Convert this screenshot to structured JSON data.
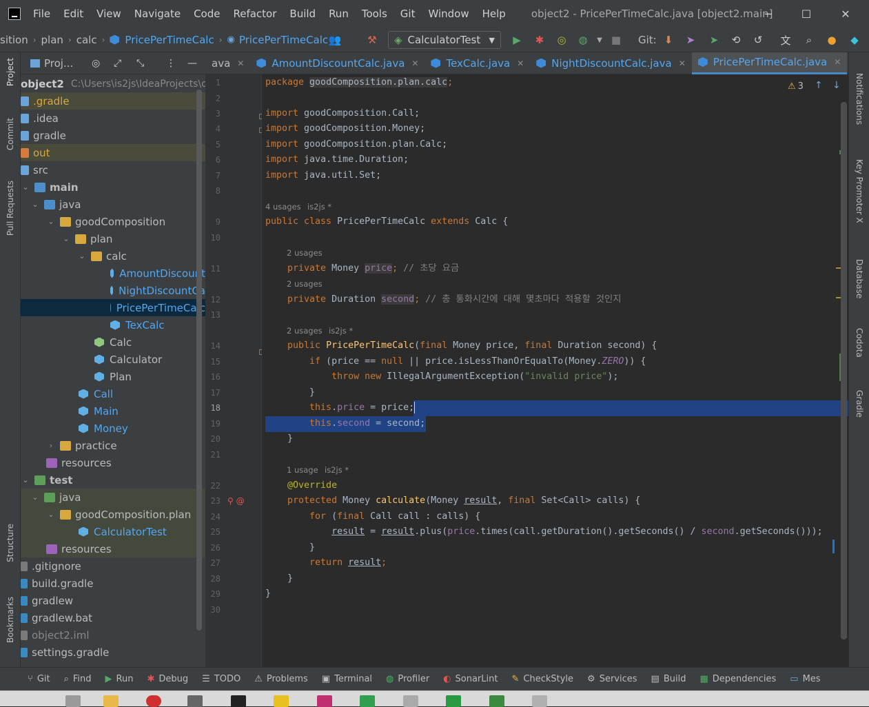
{
  "window": {
    "title": "object2 - PricePerTimeCalc.java [object2.main]",
    "minimize": "─",
    "maximize": "☐",
    "close": "✕"
  },
  "menu": [
    "File",
    "Edit",
    "View",
    "Navigate",
    "Code",
    "Refactor",
    "Build",
    "Run",
    "Tools",
    "Git",
    "Window",
    "Help"
  ],
  "breadcrumb": [
    "sition",
    "plan",
    "calc",
    "PricePerTimeCalc",
    "PricePerTimeCalc"
  ],
  "run_config": "CalculatorTest",
  "git_label": "Git:",
  "project_header": "Proj...",
  "tabs": [
    {
      "label": "ava",
      "close": "✕"
    },
    {
      "label": "AmountDiscountCalc.java",
      "close": "✕"
    },
    {
      "label": "TexCalc.java",
      "close": "✕"
    },
    {
      "label": "NightDiscountCalc.java",
      "close": "✕"
    },
    {
      "label": "PricePerTimeCalc.java",
      "close": "✕"
    }
  ],
  "left_tools": [
    "Project",
    "Commit",
    "Pull Requests",
    "Structure",
    "Bookmarks"
  ],
  "right_tools": [
    "Notifications",
    "Key Promoter X",
    "Database",
    "Codota",
    "Gradle"
  ],
  "tree": [
    {
      "label": "object2",
      "extra": "C:\\Users\\is2js\\IdeaProjects\\o"
    },
    {
      "label": ".gradle"
    },
    {
      "label": ".idea"
    },
    {
      "label": "gradle"
    },
    {
      "label": "out"
    },
    {
      "label": "src"
    },
    {
      "label": "main"
    },
    {
      "label": "java"
    },
    {
      "label": "goodComposition"
    },
    {
      "label": "plan"
    },
    {
      "label": "calc"
    },
    {
      "label": "AmountDiscount"
    },
    {
      "label": "NightDiscountCa"
    },
    {
      "label": "PricePerTimeCalc"
    },
    {
      "label": "TexCalc"
    },
    {
      "label": "Calc"
    },
    {
      "label": "Calculator"
    },
    {
      "label": "Plan"
    },
    {
      "label": "Call"
    },
    {
      "label": "Main"
    },
    {
      "label": "Money"
    },
    {
      "label": "practice"
    },
    {
      "label": "resources"
    },
    {
      "label": "test"
    },
    {
      "label": "java"
    },
    {
      "label": "goodComposition.plan"
    },
    {
      "label": "CalculatorTest"
    },
    {
      "label": "resources"
    },
    {
      "label": ".gitignore"
    },
    {
      "label": "build.gradle"
    },
    {
      "label": "gradlew"
    },
    {
      "label": "gradlew.bat"
    },
    {
      "label": "object2.iml"
    },
    {
      "label": "settings.gradle"
    }
  ],
  "warnings": "3",
  "hints": {
    "h8": "4 usages",
    "h8a": "is2js *",
    "h10": "2 usages",
    "h11": "2 usages",
    "h13": "2 usages",
    "h13a": "is2js *",
    "h21": "1 usage",
    "h21a": "is2js *"
  },
  "line_numbers": [
    "1",
    "2",
    "3",
    "4",
    "5",
    "6",
    "7",
    "8",
    "9",
    "10",
    "11",
    "12",
    "13",
    "14",
    "15",
    "16",
    "17",
    "18",
    "19",
    "20",
    "21",
    "22",
    "23",
    "24",
    "25",
    "26",
    "27",
    "28",
    "29",
    "30"
  ],
  "code": {
    "l1a": "package ",
    "l1b": "goodComposition.plan.calc",
    ";": ";",
    "l3": "goodComposition.Call;",
    "l4": "goodComposition.Money;",
    "l5": "goodComposition.plan.Calc;",
    "l6": "java.time.Duration;",
    "l7": "java.util.Set;",
    "import": "import ",
    "l9": "PricePerTimeCalc ",
    "l9b": "Calc {",
    "l11a": "    private ",
    "l11b": "Money ",
    "l11c": "price",
    "l11d": "; ",
    "l11e": "// 초당 요금",
    "l12a": "    private ",
    "l12b": "Duration ",
    "l12c": "second",
    "l12d": "; ",
    "l12e": "// 총 통화시간에 대해 몇초마다 적용할 것인지",
    "l14a": "    public ",
    "l14b": "PricePerTimeCalc",
    "l14c": "(",
    "l14d": "final ",
    "l14e": "Money price, ",
    "l14f": "final ",
    "l14g": "Duration second) {",
    "l15a": "        if ",
    "l15b": "(price == ",
    "l15c": "null ",
    "l15d": "|| price.isLessThanOrEqualTo(Money.",
    "l15e": "ZERO",
    "l15f": ")) {",
    "l16a": "            throw new ",
    "l16b": "IllegalArgumentException(",
    "l16c": "\"invalid price\"",
    "l16d": ");",
    "l17": "        }",
    "l18a": "        this",
    "l18b": ".",
    "l18c": "price",
    " l18d": " = price;",
    "l18d": " = price;",
    "l19a": "        this",
    "l19b": ".",
    "l19c": "second",
    "l19d": " = second;",
    "l20": "    }",
    "l22": "    @Override",
    "l23a": "    protected ",
    "l23b": "Money ",
    "l23c": "calculate",
    "l23d": "(Money ",
    "l23e": "result",
    ", ": ", ",
    "l23f": ", ",
    "l23g": "final ",
    "l23h": "Set<Call> calls) {",
    "l24a": "        for ",
    "l24b": "(",
    "l24c": "final ",
    "l24d": "Call call : calls) {",
    "l25a": "            ",
    "l25b": "result",
    " = ": " = ",
    "l25c": " = ",
    "l25d": "result",
    ".plus(": ".plus(",
    "l25e": ".plus(",
    "l25f": "price",
    ".times": ".times",
    "l25g": ".times(call.getDuration().getSeconds() / ",
    "l25h": "second",
    "l25i": ".getSeconds()));",
    "l26": "        }",
    "l27a": "        return ",
    "l27b": "result",
    "l27c": ";",
    "l28": "    }",
    "l29": "}",
    "public_class": "public class ",
    "extends": "extends "
  },
  "bottom_tools": [
    "Git",
    "Find",
    "Run",
    "Debug",
    "TODO",
    "Problems",
    "Terminal",
    "Profiler",
    "SonarLint",
    "CheckStyle",
    "Services",
    "Build",
    "Dependencies",
    "Mes"
  ],
  "colors": {
    "keyword": "#cc7832",
    "field": "#9876aa",
    "string": "#6a8759",
    "comment": "#808080",
    "selection": "#214283",
    "accent": "#4a88c7"
  }
}
